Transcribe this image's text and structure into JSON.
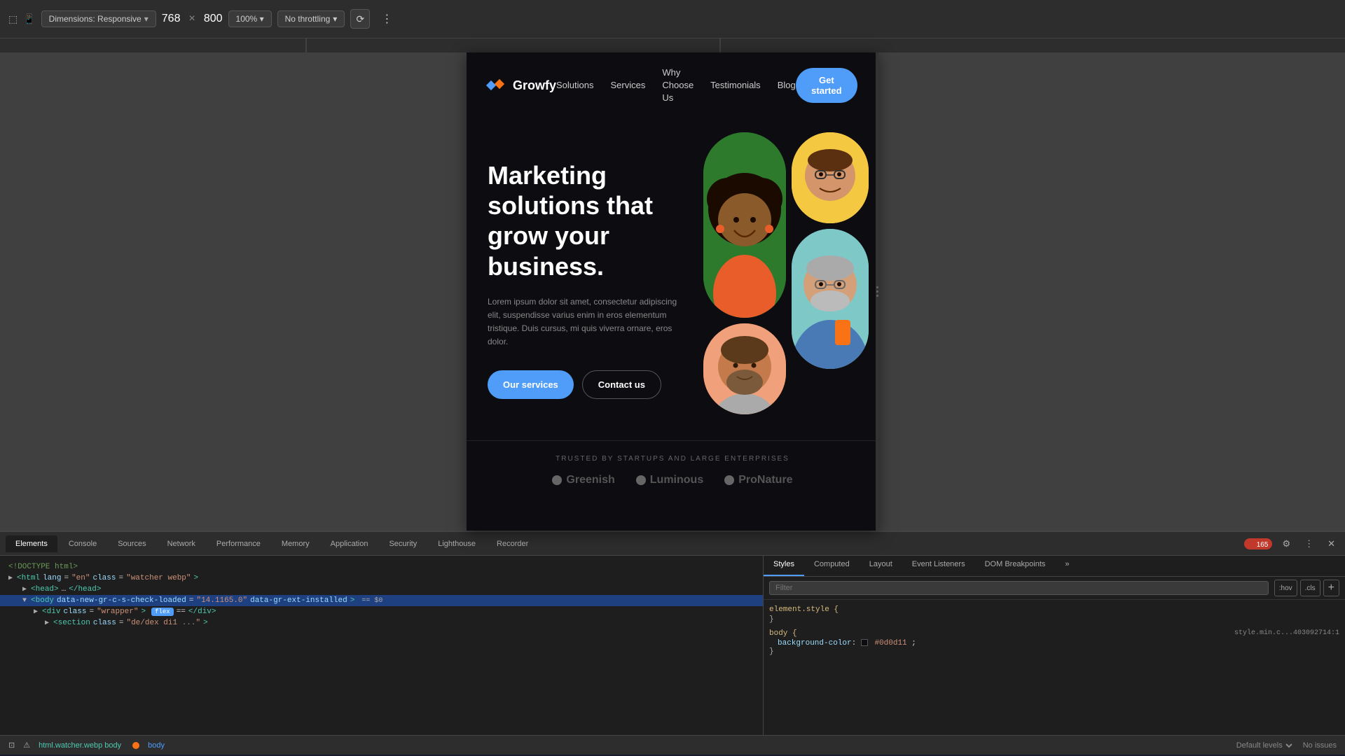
{
  "browser": {
    "dimension_selector": "Dimensions: Responsive",
    "width": "768",
    "x_sep": "×",
    "height": "800",
    "zoom": "100%",
    "throttle": "No throttling",
    "chevron": "▾",
    "more_icon": "⋮"
  },
  "nav": {
    "logo_text": "Growfy",
    "links": [
      {
        "label": "Solutions"
      },
      {
        "label": "Services"
      },
      {
        "label": "Why Choose Us"
      },
      {
        "label": "Testimonials"
      },
      {
        "label": "Blog"
      }
    ],
    "cta": "Get started"
  },
  "hero": {
    "title": "Marketing solutions that grow your business.",
    "description": "Lorem ipsum dolor sit amet, consectetur adipiscing elit, suspendisse varius enim in eros elementum tristique. Duis cursus, mi quis viverra ornare, eros dolor.",
    "btn_primary": "Our services",
    "btn_secondary": "Contact us"
  },
  "trusted": {
    "label": "TRUSTED BY STARTUPS AND LARGE ENTERPRISES",
    "logos": [
      {
        "name": "Greenish"
      },
      {
        "name": "Luminous"
      },
      {
        "name": "ProNature"
      }
    ]
  },
  "devtools": {
    "tabs": [
      "Elements",
      "Console",
      "Sources",
      "Network",
      "Performance",
      "Memory",
      "Application",
      "Security",
      "Lighthouse",
      "Recorder"
    ],
    "active_tab": "Elements",
    "error_count": "165",
    "dom_lines": [
      {
        "indent": 0,
        "content": "<!DOCTYPE html>"
      },
      {
        "indent": 0,
        "content": "<html lang=\"en\" class=\"watcher webp\">"
      },
      {
        "indent": 0,
        "content": "<head> </head>"
      },
      {
        "indent": 0,
        "content": "<body data-new-gr-c-s-check-loaded=\"14.1165.0\" data-gr-ext-installed> == $0"
      },
      {
        "indent": 1,
        "content": "<div class=\"wrapper\" > == </div>",
        "has_badge": true,
        "badge_label": "flex"
      },
      {
        "indent": 2,
        "content": "<section class=\"...\">"
      }
    ],
    "breadcrumb": {
      "items": [
        "html.watcher.webp",
        "body"
      ]
    },
    "styles": {
      "tabs": [
        "Styles",
        "Computed",
        "Layout",
        "Event Listeners",
        "DOM Breakpoints"
      ],
      "active": "Styles",
      "filter_placeholder": "Filter",
      "state_btns": [
        ":hov",
        ".cls",
        "+"
      ],
      "rules": [
        {
          "selector": "element.style {",
          "source": "",
          "properties": []
        },
        {
          "selector": "body {",
          "source": "style.min.c...403092714:1",
          "properties": [
            {
              "name": "background-color",
              "value": "#0d0d11"
            }
          ]
        }
      ]
    }
  },
  "bottom_bar": {
    "breadcrumb": "html.watcher.webp body",
    "default_levels": "Default levels",
    "no_issues": "No issues"
  }
}
